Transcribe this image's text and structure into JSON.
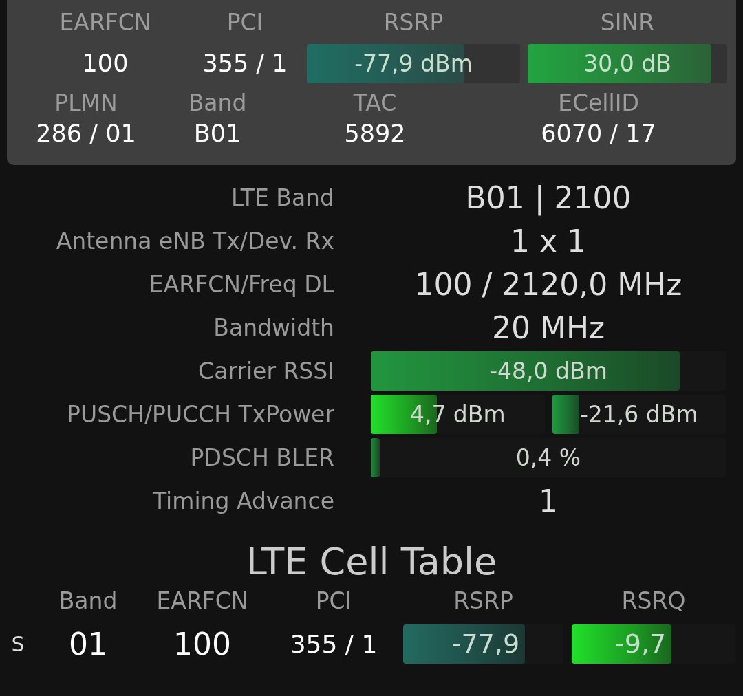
{
  "serving_cell": {
    "row_1": [
      {
        "kind": "text",
        "label": "EARFCN",
        "value": "100"
      },
      {
        "kind": "text",
        "label": "PCI",
        "value": "355 / 1"
      },
      {
        "kind": "bar",
        "label": "RSRP",
        "value": "-77,9 dBm",
        "level": 0.74,
        "color": "#1f6e63"
      },
      {
        "kind": "bar",
        "label": "SINR",
        "value": "30,0 dB",
        "level": 0.92,
        "color": "#22a540"
      }
    ],
    "row_2": [
      {
        "label": "PLMN",
        "value": "286 / 01"
      },
      {
        "label": "Band",
        "value": "B01"
      },
      {
        "label": "TAC",
        "value": "5892"
      },
      {
        "label": "ECellID",
        "value": "6070 / 17"
      }
    ]
  },
  "details": [
    {
      "kind": "text",
      "label": "LTE Band",
      "value": "B01 | 2100"
    },
    {
      "kind": "text",
      "label": "Antenna eNB Tx/Dev. Rx",
      "value": "1 x 1"
    },
    {
      "kind": "text",
      "label": "EARFCN/Freq DL",
      "value": "100 / 2120,0 MHz"
    },
    {
      "kind": "text",
      "label": "Bandwidth",
      "value": "20 MHz"
    },
    {
      "kind": "bar",
      "label": "Carrier RSSI",
      "bars": [
        {
          "value": "-48,0 dBm",
          "level": 0.87,
          "color": "#22963f"
        }
      ]
    },
    {
      "kind": "bar",
      "label": "PUSCH/PUCCH TxPower",
      "bars": [
        {
          "value": "4,7 dBm",
          "level": 0.38,
          "color": "#22e02a"
        },
        {
          "value": "-21,6 dBm",
          "level": 0.155,
          "color": "#1f9a40"
        }
      ]
    },
    {
      "kind": "bar",
      "label": "PDSCH BLER",
      "bars": [
        {
          "value": "0,4 %",
          "level": 0.025,
          "color": "#1f8a3a"
        }
      ]
    },
    {
      "kind": "text",
      "label": "Timing Advance",
      "value": "1"
    }
  ],
  "cell_table": {
    "title": "LTE Cell Table",
    "columns": [
      "Band",
      "EARFCN",
      "PCI",
      "RSRP",
      "RSRQ"
    ],
    "rows": [
      {
        "type": "S",
        "band": "01",
        "earfcn": "100",
        "pci": "355 / 1",
        "rsrp": {
          "value": "-77,9",
          "level": 0.76,
          "color": "#236a60"
        },
        "rsrq": {
          "value": "-9,7",
          "level": 0.61,
          "color": "#20e02a"
        }
      }
    ]
  }
}
